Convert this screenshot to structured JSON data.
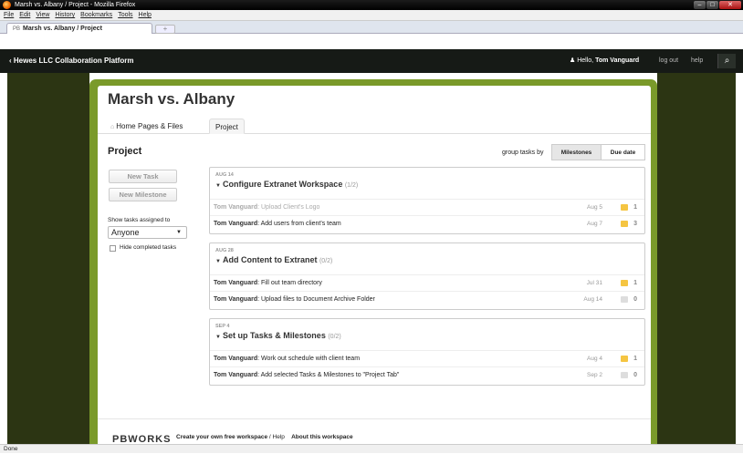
{
  "window": {
    "title": "Marsh vs. Albany / Project - Mozilla Firefox"
  },
  "menu": [
    "File",
    "Edit",
    "View",
    "History",
    "Bookmarks",
    "Tools",
    "Help"
  ],
  "browser_tab": {
    "icon_text": "PB",
    "label": "Marsh vs. Albany / Project",
    "new_tab": "+"
  },
  "topnav": {
    "brand": "Hewes LLC Collaboration Platform",
    "hello": "Hello,",
    "user": "Tom Vanguard",
    "logout": "log out",
    "help": "help"
  },
  "workspace": {
    "title": "Marsh vs. Albany"
  },
  "tabs": [
    {
      "label": "Home"
    },
    {
      "label": "Pages & Files"
    },
    {
      "label": "Project"
    }
  ],
  "project": {
    "heading": "Project",
    "group_label": "group tasks by",
    "group_options": [
      "Milestones",
      "Due date"
    ],
    "new_task": "New Task",
    "new_milestone": "New Milestone",
    "show_label": "Show tasks assigned to",
    "assigned_value": "Anyone",
    "hide_completed": "Hide completed tasks"
  },
  "milestones": [
    {
      "date": "AUG 14",
      "title": "Configure Extranet Workspace",
      "count": "(1/2)",
      "tasks": [
        {
          "who": "Tom Vanguard",
          "text": "Upload Client's Logo",
          "due": "Aug 5",
          "comments": "1",
          "done": true
        },
        {
          "who": "Tom Vanguard",
          "text": "Add users from client's team",
          "due": "Aug 7",
          "comments": "3",
          "done": false
        }
      ]
    },
    {
      "date": "AUG 28",
      "title": "Add Content to Extranet",
      "count": "(0/2)",
      "tasks": [
        {
          "who": "Tom Vanguard",
          "text": "Fill out team directory",
          "due": "Jul 31",
          "comments": "1",
          "done": false
        },
        {
          "who": "Tom Vanguard",
          "text": "Upload files to Document Archive Folder",
          "due": "Aug 14",
          "comments": "0",
          "done": false
        }
      ]
    },
    {
      "date": "SEP 4",
      "title": "Set up Tasks & Milestones",
      "count": "(0/2)",
      "tasks": [
        {
          "who": "Tom Vanguard",
          "text": "Work out schedule with client team",
          "due": "Aug 4",
          "comments": "1",
          "done": false
        },
        {
          "who": "Tom Vanguard",
          "text": "Add selected Tasks & Milestones to \"Project Tab\"",
          "due": "Sep 2",
          "comments": "0",
          "done": false
        }
      ]
    }
  ],
  "footer": {
    "logo": "PBWORKS",
    "create": "Create your own free workspace",
    "sep": " / ",
    "help": "Help",
    "about": "About this workspace"
  },
  "statusbar": "Done"
}
